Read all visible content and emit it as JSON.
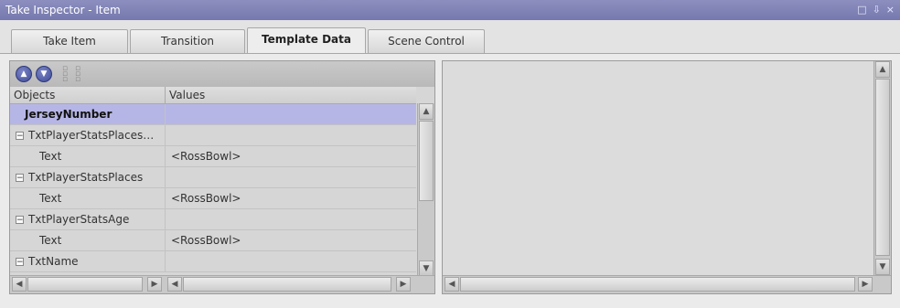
{
  "window": {
    "title": "Take Inspector - Item",
    "controls": [
      "□",
      "⇩",
      "×"
    ]
  },
  "tabs": [
    {
      "label": "Take Item",
      "active": false
    },
    {
      "label": "Transition",
      "active": false
    },
    {
      "label": "Template Data",
      "active": true
    },
    {
      "label": "Scene Control",
      "active": false
    }
  ],
  "grid": {
    "columns": [
      "Objects",
      "Values"
    ],
    "rows": [
      {
        "object": "JerseyNumber",
        "value": "",
        "type": "selected"
      },
      {
        "object": "TxtPlayerStatsPlaces…",
        "value": "",
        "type": "group"
      },
      {
        "object": "Text",
        "value": "<RossBowl>",
        "type": "child"
      },
      {
        "object": "TxtPlayerStatsPlaces",
        "value": "",
        "type": "group"
      },
      {
        "object": "Text",
        "value": "<RossBowl>",
        "type": "child"
      },
      {
        "object": "TxtPlayerStatsAge",
        "value": "",
        "type": "group"
      },
      {
        "object": "Text",
        "value": "<RossBowl>",
        "type": "child"
      },
      {
        "object": "TxtName",
        "value": "",
        "type": "group"
      }
    ]
  },
  "icons": {
    "collapse": "−",
    "move_up": "up-circle-icon",
    "move_down": "down-circle-icon",
    "expand_tree": "tree-expand-icon",
    "collapse_tree": "tree-collapse-icon"
  }
}
